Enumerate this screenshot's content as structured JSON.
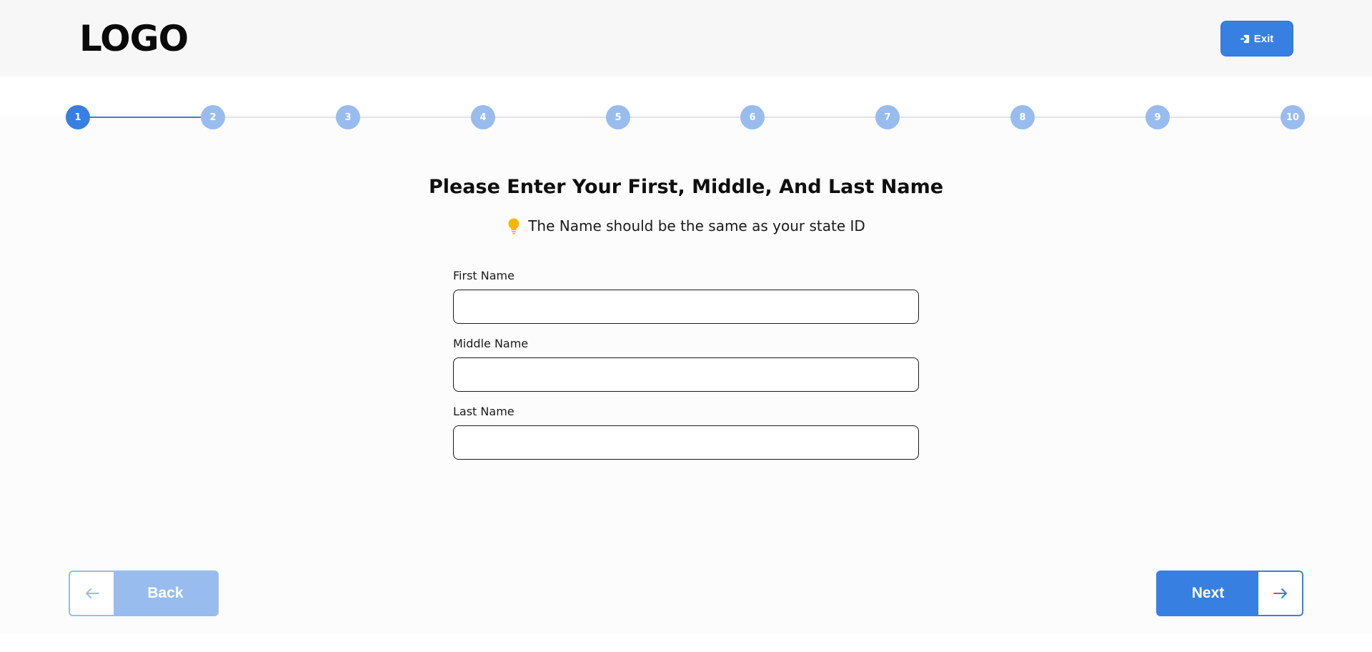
{
  "header": {
    "logo": "LOGO",
    "exit_label": "Exit"
  },
  "stepper": {
    "current": 1,
    "steps": [
      "1",
      "2",
      "3",
      "4",
      "5",
      "6",
      "7",
      "8",
      "9",
      "10"
    ]
  },
  "main": {
    "title": "Please Enter Your First, Middle, And Last Name",
    "hint": "The Name should be the same as your state ID",
    "hint_icon": "lightbulb-icon",
    "fields": [
      {
        "label": "First Name",
        "value": "",
        "placeholder": ""
      },
      {
        "label": "Middle Name",
        "value": "",
        "placeholder": ""
      },
      {
        "label": "Last Name",
        "value": "",
        "placeholder": ""
      }
    ]
  },
  "footer": {
    "back_label": "Back",
    "next_label": "Next"
  },
  "colors": {
    "accent": "#3780e1",
    "accent_light": "#98bcee",
    "hint_icon": "#f5b800"
  }
}
